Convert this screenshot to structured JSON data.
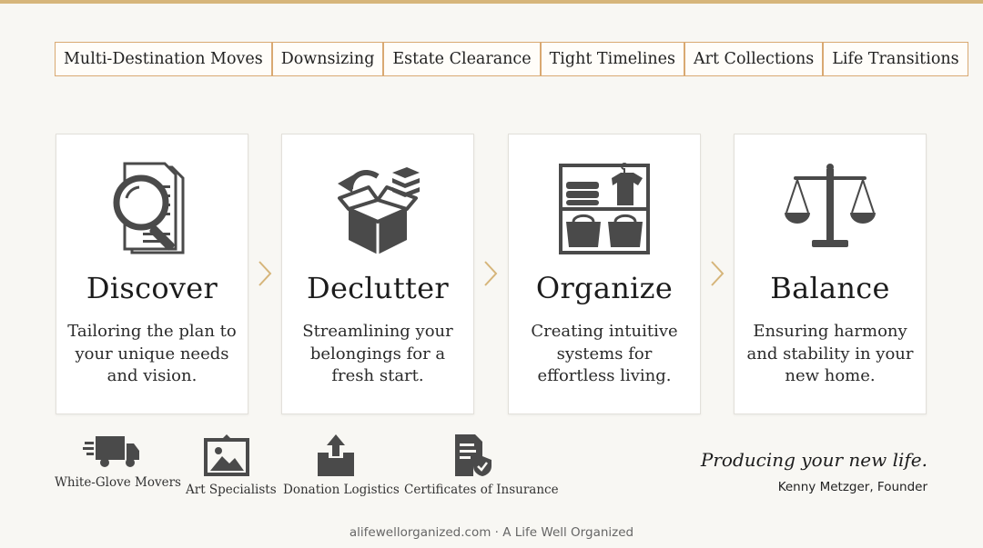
{
  "tags": [
    "Multi-Destination Moves",
    "Downsizing",
    "Estate Clearance",
    "Tight Timelines",
    "Art Collections",
    "Life Transitions"
  ],
  "steps": [
    {
      "icon": "magnifier-document-icon",
      "title": "Discover",
      "desc": "Tailoring the plan to your unique needs and vision."
    },
    {
      "icon": "open-box-icon",
      "title": "Declutter",
      "desc": "Streamlining your belongings for a fresh start."
    },
    {
      "icon": "closet-shelves-icon",
      "title": "Organize",
      "desc": "Creating intuitive systems for effortless living."
    },
    {
      "icon": "balance-scale-icon",
      "title": "Balance",
      "desc": "Ensuring harmony and stability in your new home."
    }
  ],
  "features": [
    {
      "icon": "moving-truck-icon",
      "label": "White-Glove Movers"
    },
    {
      "icon": "framed-picture-icon",
      "label": "Art Specialists"
    },
    {
      "icon": "donation-box-icon",
      "label": "Donation Logistics"
    },
    {
      "icon": "insurance-certificate-icon",
      "label": "Certificates of Insurance"
    }
  ],
  "tagline": "Producing your new life.",
  "founder": "Kenny Metzger, Founder",
  "footer": "alifewellorganized.com · A Life Well Organized",
  "colors": {
    "accent": "#d6b57a",
    "tag_border": "#d9a972",
    "icon": "#4a4a4a",
    "background": "#f8f7f3"
  }
}
